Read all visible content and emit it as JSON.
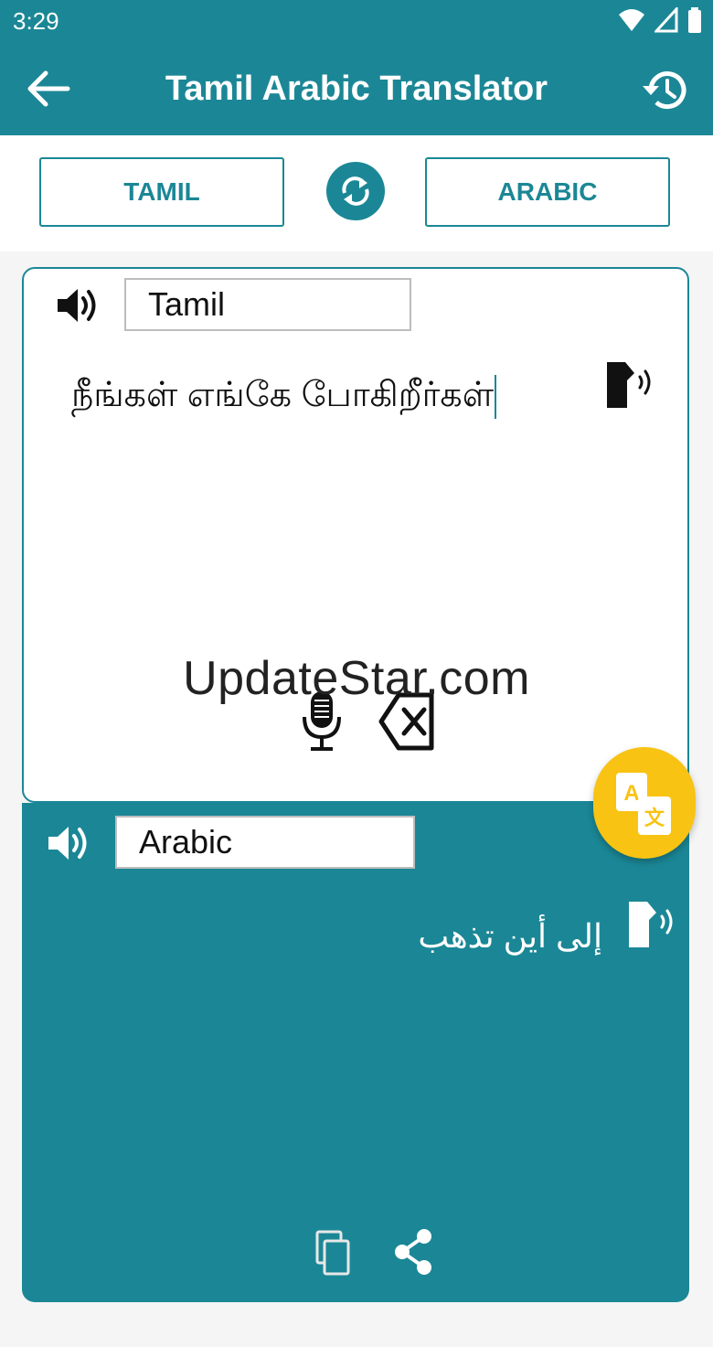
{
  "status": {
    "time": "3:29"
  },
  "appbar": {
    "title": "Tamil Arabic Translator",
    "back_icon": "arrow-left-icon",
    "history_icon": "history-icon"
  },
  "languages": {
    "source": "TAMIL",
    "target": "ARABIC",
    "swap_icon": "swap-icon"
  },
  "source_panel": {
    "language_label": "Tamil",
    "text": "நீங்கள் எங்கே போகிறீர்கள்",
    "speaker_icon": "speaker-icon",
    "speak_icon": "text-to-speech-icon",
    "mic_icon": "microphone-icon",
    "clear_icon": "backspace-icon"
  },
  "target_panel": {
    "language_label": "Arabic",
    "text": "إلى أين تذهب",
    "speaker_icon": "speaker-icon",
    "speak_icon": "text-to-speech-icon",
    "copy_icon": "copy-icon",
    "share_icon": "share-icon"
  },
  "watermark": "UpdateStar.com",
  "colors": {
    "primary": "#1b8796",
    "accent": "#f8c313"
  }
}
